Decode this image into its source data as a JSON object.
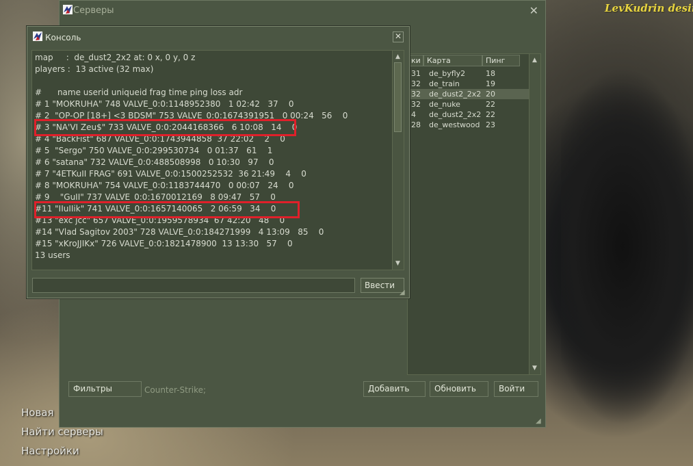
{
  "brand": "LevKudrin desing",
  "main_menu": [
    "Новая",
    "Найти серверы",
    "Настройки"
  ],
  "servers_window": {
    "title": "Серверы",
    "columns": [
      "ки",
      "Карта",
      "Пинг"
    ],
    "rows": [
      {
        "players": "31",
        "map": "de_byfly2",
        "ping": "18",
        "selected": false
      },
      {
        "players": "32",
        "map": "de_train",
        "ping": "19",
        "selected": false
      },
      {
        "players": "32",
        "map": "de_dust2_2x2",
        "ping": "20",
        "selected": true
      },
      {
        "players": "32",
        "map": "de_nuke",
        "ping": "22",
        "selected": false
      },
      {
        "players": "4",
        "map": "de_dust2_2x2",
        "ping": "22",
        "selected": false
      },
      {
        "players": "28",
        "map": "de_westwood",
        "ping": "23",
        "selected": false
      }
    ],
    "filters_button": "Фильтры",
    "game_filter": "Counter-Strike;",
    "add_button": "Добавить",
    "refresh_button": "Обновить",
    "join_button": "Войти"
  },
  "console": {
    "title": "Консоль",
    "lines": [
      "map     :  de_dust2_2x2 at: 0 x, 0 y, 0 z",
      "players :  13 active (32 max)",
      "",
      "#      name userid uniqueid frag time ping loss adr",
      "# 1 \"MOKRUHA\" 748 VALVE_0:0:1148952380   1 02:42   37    0",
      "# 2  \"OP-OP [18+] <3 BDSM\" 753 VALVE_0:0:1674391951   0 00:24   56    0",
      "# 3 \"NA'VI Zeu$\" 733 VALVE_0:0:2044168366   6 10:08   14    0",
      "# 4 \"BackFist\" 687 VALVE_0:0:1743944858  37 22:02    2    0",
      "# 5  \"Sergo\" 750 VALVE_0:0:299530734   0 01:37   61    1",
      "# 6 \"satana\" 732 VALVE_0:0:488508998   0 10:30   97    0",
      "# 7 \"4ETKuII FRAG\" 691 VALVE_0:0:1500252532  36 21:49    4    0",
      "# 8 \"MOKRUHA\" 754 VALVE_0:0:1183744470   0 00:07   24    0",
      "# 9    \"GuII\" 737 VALVE_0:0:1670012169   8 09:47   57    0",
      "#11 \"IIuIIik\" 741 VALVE_0:0:1657140065   2 06:59   34    0",
      "#13 \"exc jcc\" 657 VALVE_0:0:1959578934  67 42:20   48    0",
      "#14 \"Vlad Sagitov 2003\" 728 VALVE_0:0:184271999   4 13:09   85    0",
      "#15 \"xKroJJIKx\" 726 VALVE_0:0:1821478900  13 13:30   57    0",
      "13 users"
    ],
    "highlighted_lines": [
      4,
      11
    ],
    "input_value": "",
    "submit_button": "Ввести"
  }
}
